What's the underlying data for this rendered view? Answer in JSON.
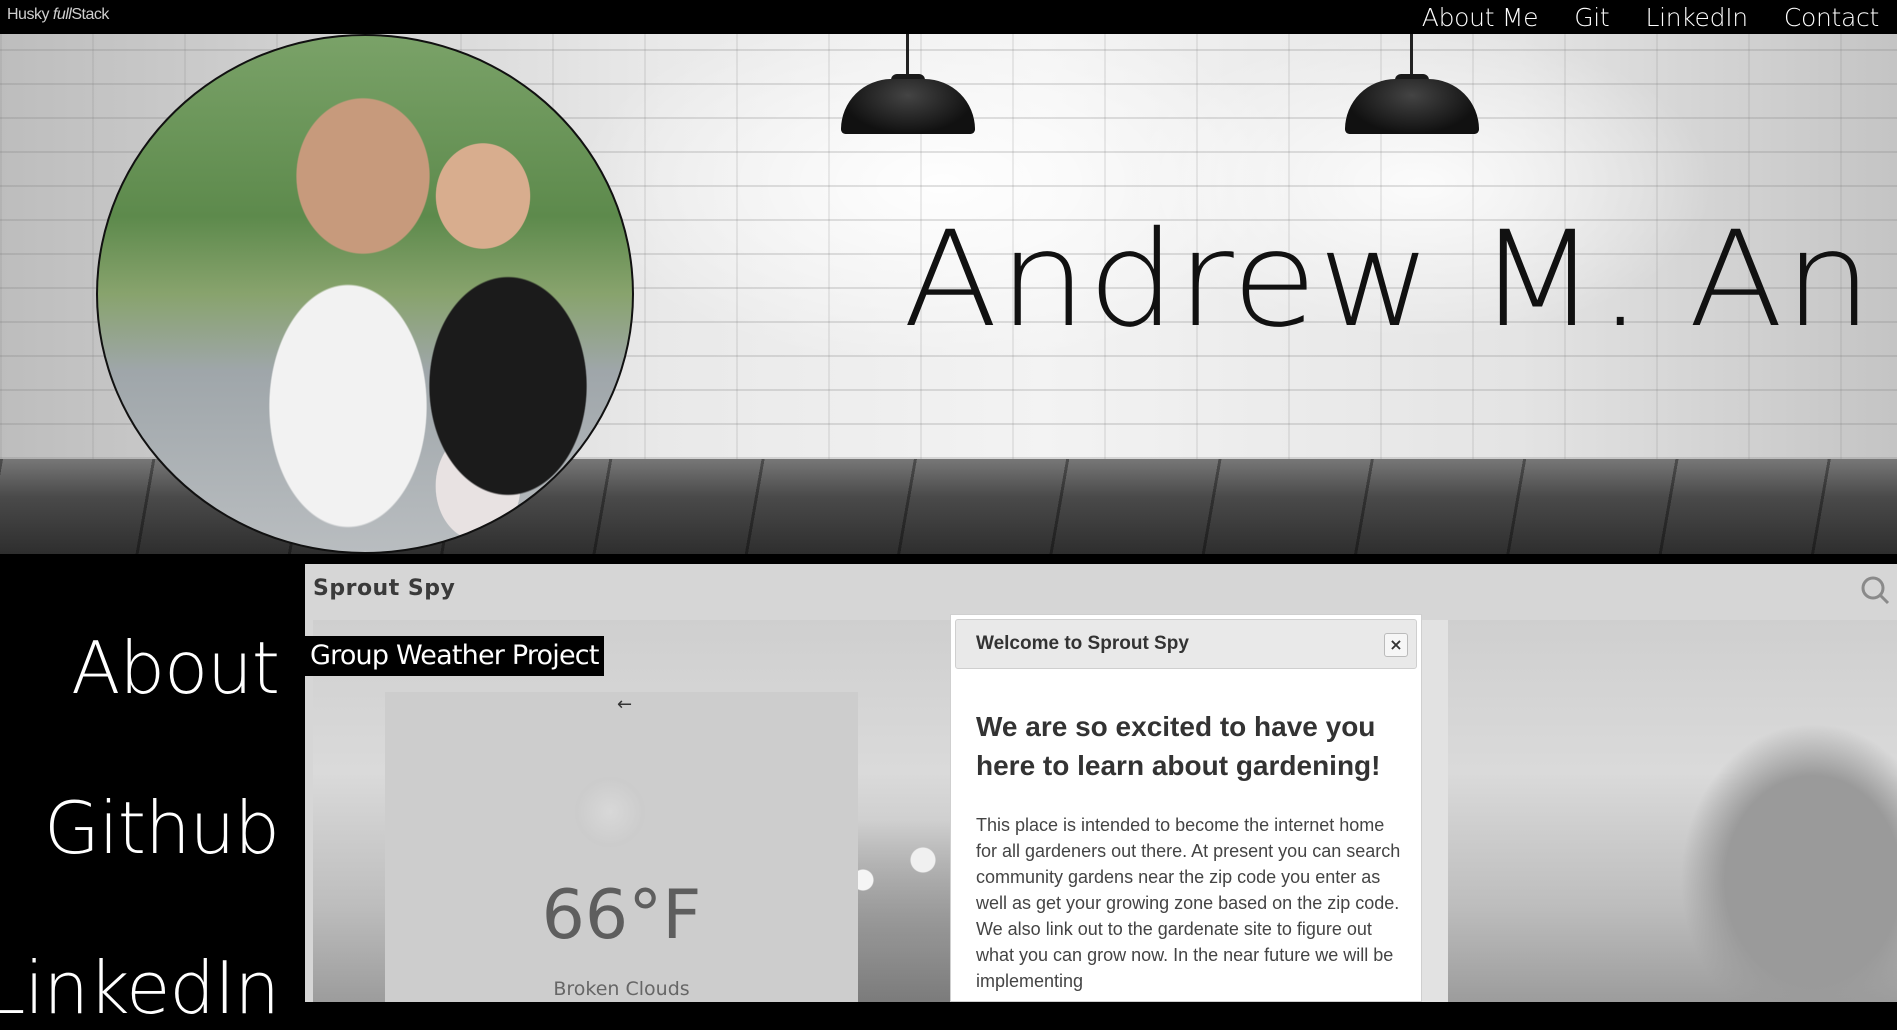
{
  "topbar": {
    "brand_prefix": "Husky",
    "brand_emphasis": "full",
    "brand_suffix": "Stack",
    "nav": [
      "About Me",
      "Git",
      "LinkedIn",
      "Contact"
    ]
  },
  "hero": {
    "name": "Andrew M. An"
  },
  "sidebar": {
    "links": [
      "About",
      "Github",
      "LinkedIn"
    ]
  },
  "project": {
    "label": "Group Weather Project",
    "app_title": "Sprout Spy",
    "weather": {
      "temperature": "66°F",
      "condition": "Broken Clouds"
    },
    "modal": {
      "title": "Welcome to Sprout Spy",
      "close": "×",
      "heading": "We are so excited to have you here to learn about gardening!",
      "body": "This place is intended to become the internet home for all gardeners out there. At present you can search community gardens near the zip code you enter as well as get your growing zone based on the zip code. We also link out to the gardenate site to figure out what you can grow now. In the near future we will be implementing"
    }
  },
  "icons": {
    "search": "search-icon",
    "back_arrow": "←",
    "close": "close-icon",
    "weather": "sun-icon"
  }
}
